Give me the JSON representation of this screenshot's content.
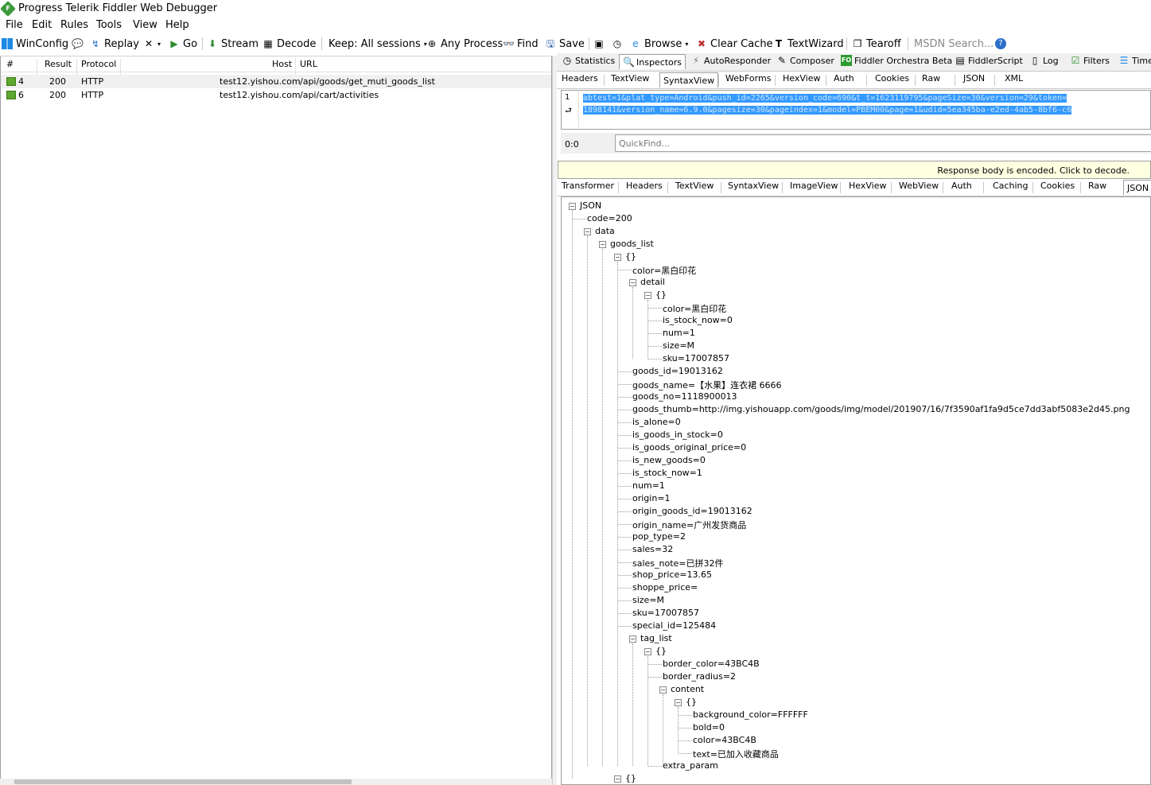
{
  "app": {
    "title": "Progress Telerik Fiddler Web Debugger"
  },
  "menu": [
    "File",
    "Edit",
    "Rules",
    "Tools",
    "View",
    "Help"
  ],
  "toolbar": {
    "winconfig": "WinConfig",
    "replay": "Replay",
    "go": "Go",
    "stream": "Stream",
    "decode": "Decode",
    "keep": "Keep: All sessions",
    "process": "Any Process",
    "find": "Find",
    "save": "Save",
    "browse": "Browse",
    "clear_cache": "Clear Cache",
    "textwizard": "TextWizard",
    "tearoff": "Tearoff",
    "msdn": "MSDN Search..."
  },
  "sessions": {
    "columns": [
      "#",
      "Result",
      "Protocol",
      "Host",
      "URL"
    ],
    "rows": [
      {
        "id": "4",
        "result": "200",
        "protocol": "HTTP",
        "host": "test12.yishou.com",
        "url": "/api/goods/get_muti_goods_list"
      },
      {
        "id": "6",
        "result": "200",
        "protocol": "HTTP",
        "host": "test12.yishou.com",
        "url": "/api/cart/activities"
      }
    ]
  },
  "top_tabs": [
    "Statistics",
    "Inspectors",
    "AutoResponder",
    "Composer",
    "Fiddler Orchestra Beta",
    "FiddlerScript",
    "Log",
    "Filters",
    "Time"
  ],
  "request_tabs": [
    "Headers",
    "TextView",
    "SyntaxView",
    "WebForms",
    "HexView",
    "Auth",
    "Cookies",
    "Raw",
    "JSON",
    "XML"
  ],
  "request": {
    "line_numbers": [
      "1"
    ],
    "line1": "abtest=1&plat_type=Android&push_id=2265&version_code=690&t_t=1623119795&pageSize=30&version=29&token=",
    "line2": "1898141&version_name=6.9.0&pagesize=30&pageindex=1&model=PBEM00&page=1&udid=5ea345ba-e2ed-4ab5-8bf6-c6",
    "position": "0:0",
    "quickfind_placeholder": "QuickFind..."
  },
  "notice": "Response body is encoded. Click to decode.",
  "response_tabs": [
    "Transformer",
    "Headers",
    "TextView",
    "SyntaxView",
    "ImageView",
    "HexView",
    "WebView",
    "Auth",
    "Caching",
    "Cookies",
    "Raw",
    "JSON"
  ],
  "tree": [
    "JSON",
    "code=200",
    "data",
    "goods_list",
    "{}",
    "color=黑白印花",
    "detail",
    "{}",
    "color=黑白印花",
    "is_stock_now=0",
    "num=1",
    "size=M",
    "sku=17007857",
    "goods_id=19013162",
    "goods_name=【水果】连衣裙 6666",
    "goods_no=1118900013",
    "goods_thumb=http://img.yishouapp.com/goods/img/model/201907/16/7f3590af1fa9d5ce7dd3abf5083e2d45.png",
    "is_alone=0",
    "is_goods_in_stock=0",
    "is_goods_original_price=0",
    "is_new_goods=0",
    "is_stock_now=1",
    "num=1",
    "origin=1",
    "origin_goods_id=19013162",
    "origin_name=广州发货商品",
    "pop_type=2",
    "sales=32",
    "sales_note=已拼32件",
    "shop_price=13.65",
    "shoppe_price=",
    "size=M",
    "sku=17007857",
    "special_id=125484",
    "tag_list",
    "{}",
    "border_color=43BC4B",
    "border_radius=2",
    "content",
    "{}",
    "background_color=FFFFFF",
    "bold=0",
    "color=43BC4B",
    "text=已加入收藏商品",
    "extra_param",
    "{}"
  ]
}
